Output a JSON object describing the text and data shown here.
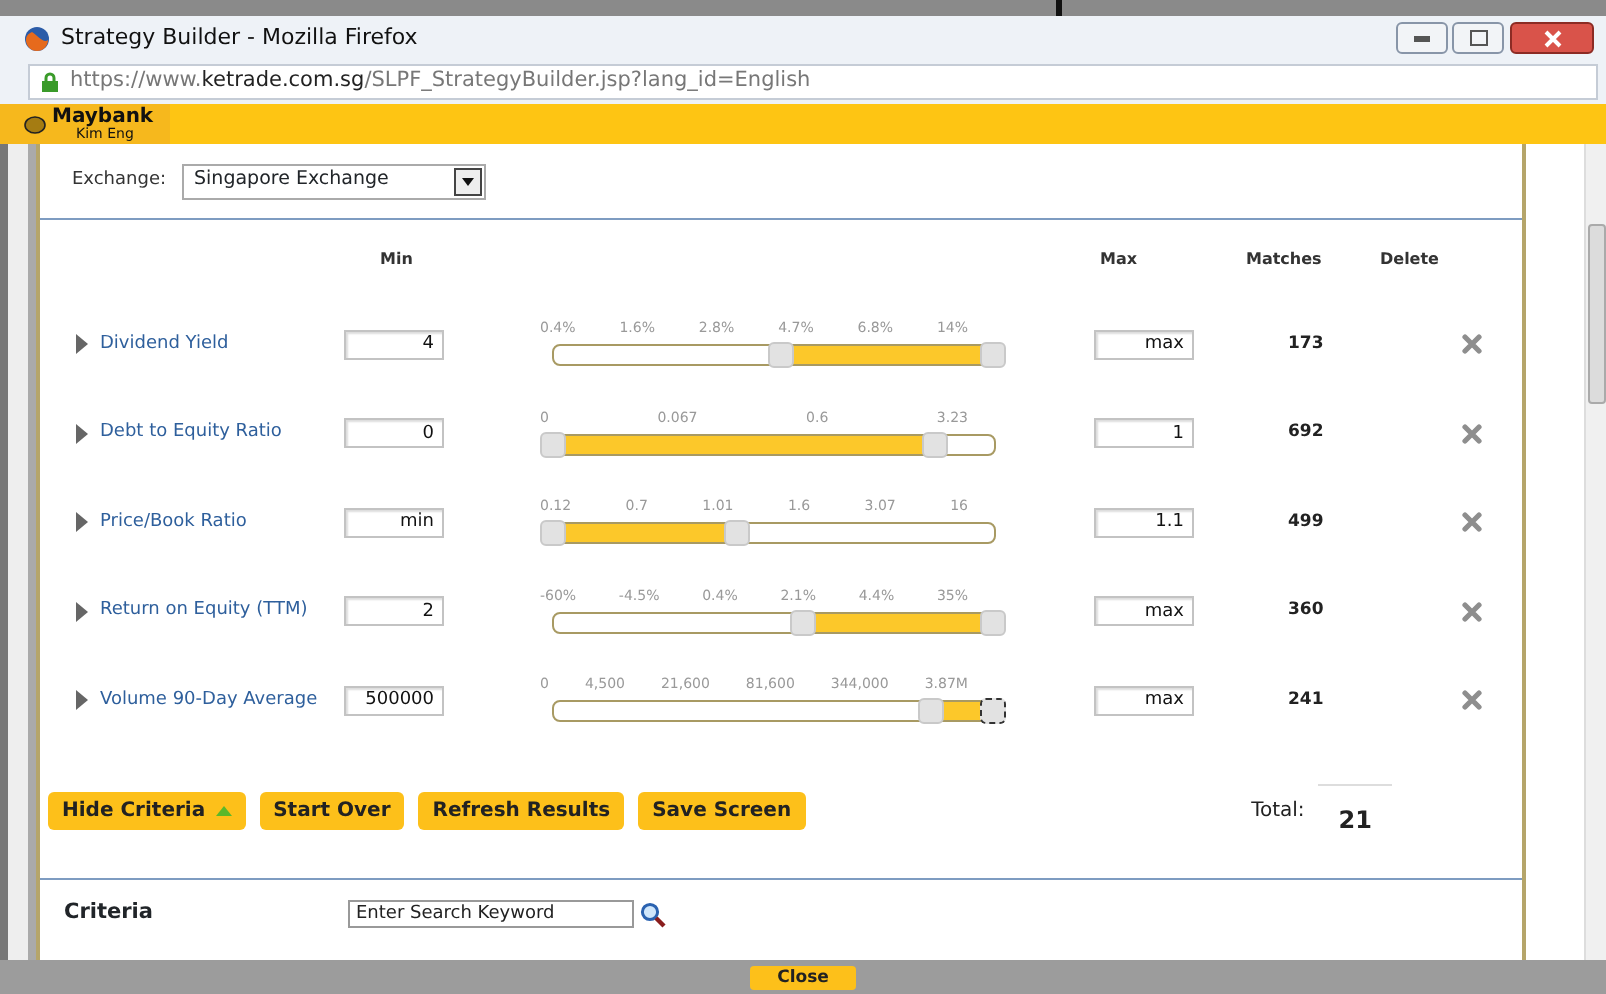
{
  "window": {
    "title": "Strategy Builder - Mozilla Firefox"
  },
  "address_bar": {
    "scheme": "https://www.",
    "domain": "ketrade.com.sg",
    "path": "/SLPF_StrategyBuilder.jsp?lang_id=English"
  },
  "brand": {
    "name": "Maybank",
    "sub": "Kim Eng"
  },
  "exchange": {
    "label": "Exchange:",
    "value": "Singapore Exchange"
  },
  "columns": {
    "min": "Min",
    "max": "Max",
    "matches": "Matches",
    "delete": "Delete"
  },
  "criteria": [
    {
      "name": "Dividend Yield",
      "min": "4",
      "max": "max",
      "matches": "173",
      "ticks": [
        "0.4%",
        "1.6%",
        "2.8%",
        "4.7%",
        "6.8%",
        "14%"
      ],
      "thumbs": [
        {
          "focused": false
        },
        {
          "focused": false
        }
      ]
    },
    {
      "name": "Debt to Equity Ratio",
      "min": "0",
      "max": "1",
      "matches": "692",
      "ticks": [
        "0",
        "0.067",
        "0.6",
        "3.23"
      ],
      "thumbs": [
        {
          "focused": false
        },
        {
          "focused": false
        }
      ]
    },
    {
      "name": "Price/Book Ratio",
      "min": "min",
      "max": "1.1",
      "matches": "499",
      "ticks": [
        "0.12",
        "0.7",
        "1.01",
        "1.6",
        "3.07",
        "16"
      ],
      "thumbs": [
        {
          "focused": false
        },
        {
          "focused": false
        }
      ]
    },
    {
      "name": "Return on Equity (TTM)",
      "min": "2",
      "max": "max",
      "matches": "360",
      "ticks": [
        "-60%",
        "-4.5%",
        "0.4%",
        "2.1%",
        "4.4%",
        "35%"
      ],
      "thumbs": [
        {
          "focused": false
        },
        {
          "focused": false
        }
      ]
    },
    {
      "name": "Volume 90-Day Average",
      "min": "500000",
      "max": "max",
      "matches": "241",
      "ticks": [
        "0",
        "4,500",
        "21,600",
        "81,600",
        "344,000",
        "3.87M"
      ],
      "thumbs": [
        {
          "focused": false
        },
        {
          "focused": true
        }
      ]
    }
  ],
  "buttons": [
    {
      "label": "Hide Criteria",
      "kind": "collapse"
    },
    {
      "label": "Start Over",
      "kind": "plain"
    },
    {
      "label": "Refresh Results",
      "kind": "plain"
    },
    {
      "label": "Save Screen",
      "kind": "plain"
    }
  ],
  "total": {
    "label": "Total:",
    "value": "21"
  },
  "criteria_search": {
    "label": "Criteria",
    "placeholder": "Enter Search Keyword"
  },
  "close_button": "Close"
}
